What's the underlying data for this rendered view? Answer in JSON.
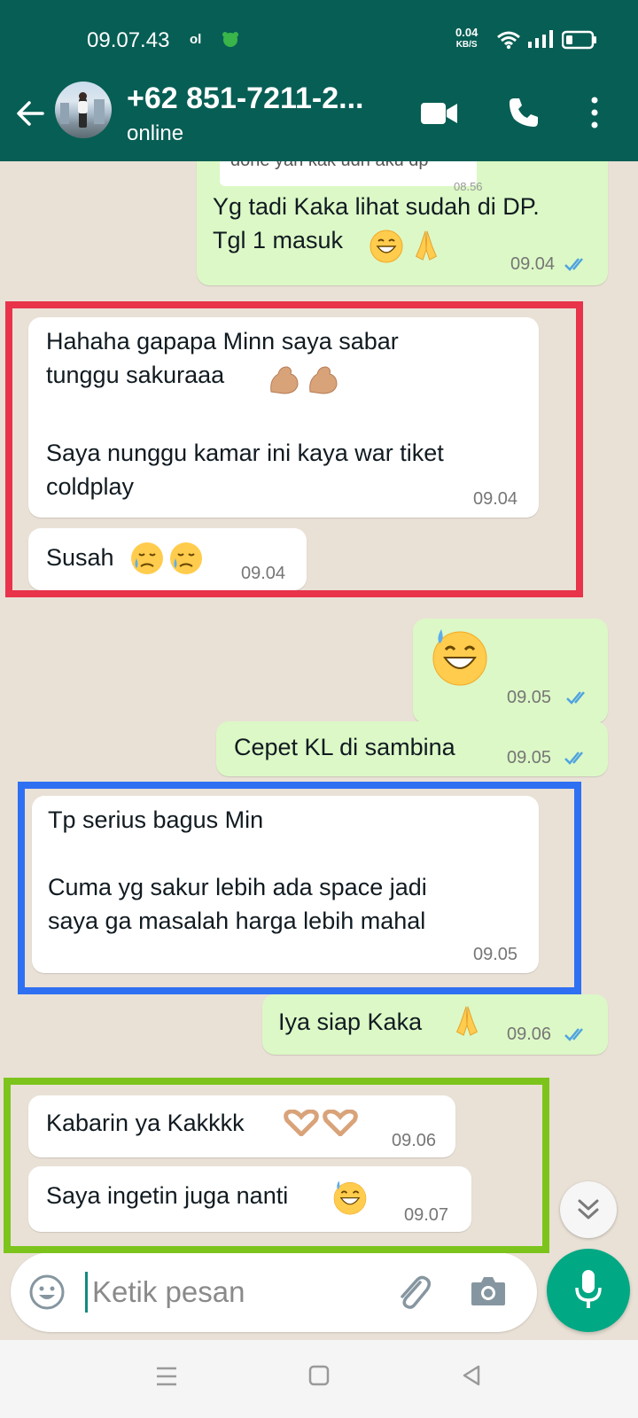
{
  "status_bar": {
    "time": "09.07.43",
    "indicator": "ol",
    "net_speed_value": "0.04",
    "net_speed_unit": "KB/S"
  },
  "header": {
    "contact_name": "+62 851-7211-2...",
    "contact_status": "online"
  },
  "messages": [
    {
      "id": "quoted",
      "direction": "out",
      "text": "done yah kak udh aku dp",
      "time": "08.56"
    },
    {
      "id": "m1",
      "direction": "out",
      "text": "Yg tadi Kaka lihat sudah di DP.\nTgl 1 masuk",
      "time": "09.04",
      "read": true
    },
    {
      "id": "m2",
      "direction": "in",
      "text": "Hahaha gapapa Minn saya sabar\ntunggu sakuraaa",
      "text2": "Saya nunggu kamar ini kaya war tiket\ncoldplay",
      "time": "09.04"
    },
    {
      "id": "m3",
      "direction": "in",
      "text": "Susah",
      "time": "09.04"
    },
    {
      "id": "m4",
      "direction": "out",
      "text": "",
      "time": "09.05",
      "read": true
    },
    {
      "id": "m5",
      "direction": "out",
      "text": "Cepet KL di sambina",
      "time": "09.05",
      "read": true
    },
    {
      "id": "m6",
      "direction": "in",
      "text": "Tp serius bagus Min",
      "text2": "Cuma yg sakur lebih ada space jadi\nsaya ga masalah harga lebih mahal",
      "time": "09.05"
    },
    {
      "id": "m7",
      "direction": "out",
      "text": "Iya siap Kaka",
      "time": "09.06",
      "read": true
    },
    {
      "id": "m8",
      "direction": "in",
      "text": "Kabarin ya Kakkkk",
      "time": "09.06"
    },
    {
      "id": "m9",
      "direction": "in",
      "text": "Saya ingetin juga nanti",
      "time": "09.07"
    }
  ],
  "highlights": {
    "red": "#e8334a",
    "blue": "#2f6ff2",
    "green": "#7cc41c"
  },
  "input": {
    "placeholder": "Ketik pesan"
  },
  "colors": {
    "header": "#075e54",
    "outgoing": "#dcf8c6",
    "incoming": "#ffffff",
    "accent": "#00a884",
    "tick": "#4fa3e0"
  },
  "icons": [
    "back-arrow-icon",
    "video-call-icon",
    "phone-icon",
    "more-vertical-icon",
    "emoji-icon",
    "attach-icon",
    "camera-icon",
    "mic-icon",
    "chevron-double-down-icon"
  ]
}
